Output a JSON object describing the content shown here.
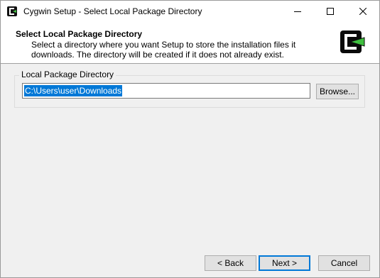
{
  "window": {
    "title": "Cygwin Setup - Select Local Package Directory",
    "icon": "cygwin-icon"
  },
  "header": {
    "title": "Select Local Package Directory",
    "description_line1": "Select a directory where you want Setup to store the installation files it",
    "description_line2": "downloads.  The directory will be created if it does not already exist.",
    "logo": "cygwin-logo"
  },
  "group": {
    "legend": "Local Package Directory",
    "path_value": "C:\\Users\\user\\Downloads",
    "browse_label": "Browse..."
  },
  "footer": {
    "back_label": "< Back",
    "next_label": "Next >",
    "cancel_label": "Cancel"
  },
  "colors": {
    "accent": "#0078d7",
    "logo_green": "#3fbf3f"
  }
}
